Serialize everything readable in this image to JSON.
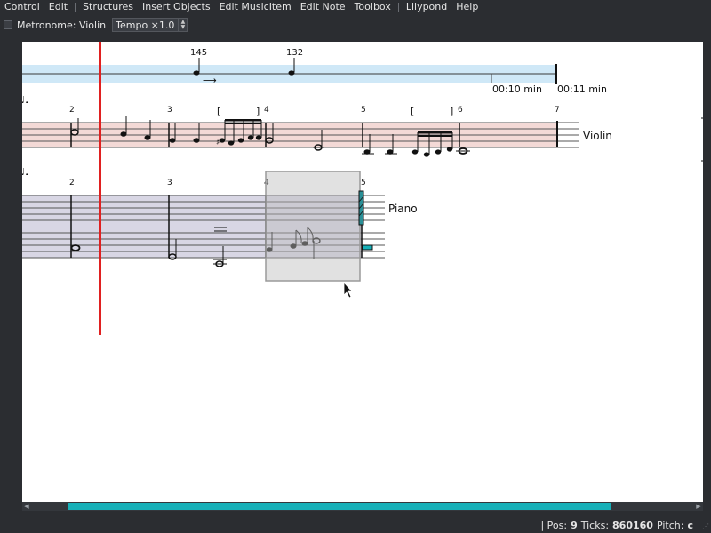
{
  "menubar": {
    "items": [
      "Control",
      "Edit",
      "Structures",
      "Insert Objects",
      "Edit MusicItem",
      "Edit Note",
      "Toolbox",
      "Lilypond",
      "Help"
    ]
  },
  "toolbar": {
    "metronome_label": "Metronome: Violin",
    "tempo_value": "Tempo ×1.0"
  },
  "timeline": {
    "tempo_marks": [
      "145",
      "132"
    ],
    "times": [
      "00:10 min",
      "00:11 min"
    ]
  },
  "staves": [
    {
      "name": "Violin",
      "prefix": "♩♩",
      "measures": [
        "2",
        "3",
        "4",
        "5",
        "6",
        "7"
      ],
      "tuplet_marks": [
        "[",
        "]",
        "[",
        "]"
      ]
    },
    {
      "name": "Piano",
      "prefix": "♩♩",
      "measures": [
        "2",
        "3",
        "4",
        "5"
      ]
    }
  ],
  "status": {
    "pos_label": "| Pos:",
    "pos_value": "9",
    "ticks_label": "Ticks:",
    "ticks_value": "860160",
    "pitch_label": "Pitch:",
    "pitch_value": "c"
  },
  "colors": {
    "timeline_band": "#cfe8f7",
    "violin_band": "#f3d9d6",
    "piano_band": "#d8d6e4",
    "playhead": "#e02020",
    "selection": "#c8c8c8",
    "scroll_thumb": "#17b0b8"
  },
  "icons": [
    "checkbox-icon",
    "spin-up-icon",
    "spin-down-icon",
    "arrow-left-icon",
    "arrow-right-icon",
    "mouse-cursor-icon",
    "resize-grip-icon"
  ]
}
